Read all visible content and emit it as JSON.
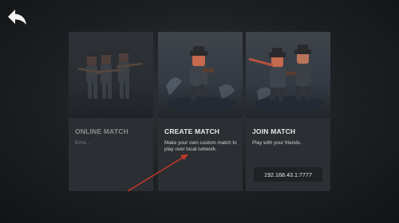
{
  "back": {
    "icon": "back-arrow-icon"
  },
  "cards": [
    {
      "title": "ONLINE MATCH",
      "description": "Error..."
    },
    {
      "title": "CREATE MATCH",
      "description": "Make your own custom match to play over local network."
    },
    {
      "title": "JOIN MATCH",
      "description": "Play with your friends.",
      "ip": "192.168.43.1:7777"
    }
  ],
  "colors": {
    "accent_arrow": "#c0392b",
    "background": "#1c1f22",
    "card": "#2b2e32"
  }
}
